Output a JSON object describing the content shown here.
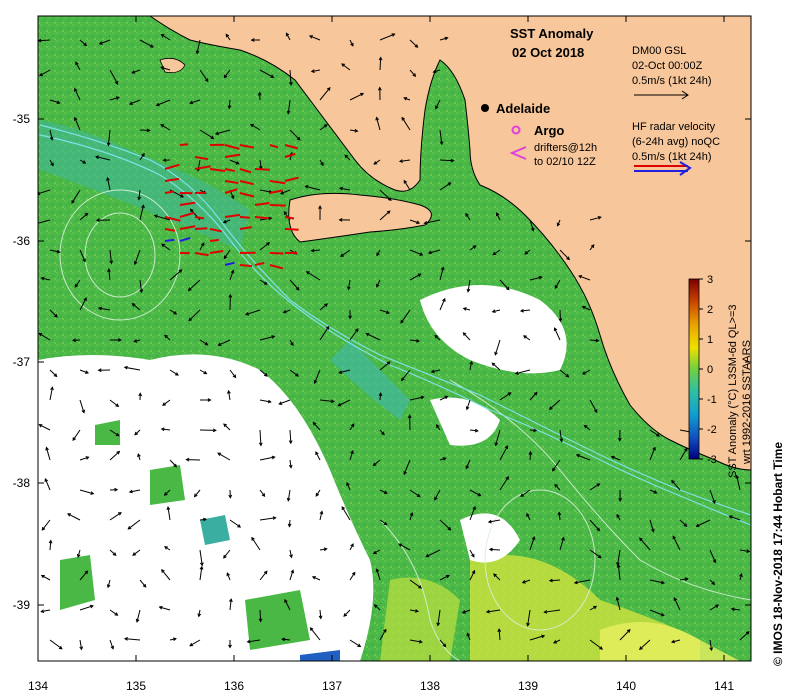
{
  "map": {
    "title_line1": "SST Anomaly",
    "title_line2": "02 Oct 2018",
    "x_ticks": [
      "134",
      "135",
      "136",
      "137",
      "138",
      "139",
      "140",
      "141"
    ],
    "y_ticks": [
      "-35",
      "-36",
      "-37",
      "-38",
      "-39"
    ],
    "land_color": "#f7c69a",
    "ocean_color": "#49b845",
    "no_data_color": "#ffffff"
  },
  "places": {
    "adelaide": "Adelaide"
  },
  "legend": {
    "argo_label": "Argo",
    "drifters_line1": "drifters@12h",
    "drifters_line2": "to 02/10 12Z",
    "gsl_line1": "DM00 GSL",
    "gsl_line2": "02-Oct 00:00Z",
    "gsl_line3": "0.5m/s (1kt 24h)",
    "hf_line1": "HF radar velocity",
    "hf_line2": "(6-24h avg) noQC",
    "hf_line3": "0.5m/s (1kt 24h)"
  },
  "colorbar": {
    "ticks": [
      "3",
      "2",
      "1",
      "0",
      "-1",
      "-2",
      "-3"
    ],
    "label_line1": "SST Anomaly (°C) L3SM-6d QL>=3",
    "label_line2": "wrt 1992-2016 SSTAARS",
    "gradient": [
      "#7a0000",
      "#c84000",
      "#e8a000",
      "#f0e000",
      "#a0e030",
      "#40c040",
      "#10b0b0",
      "#1070d0",
      "#000080"
    ]
  },
  "credit": "© IMOS 18-Nov-2018 17:44 Hobart Time"
}
